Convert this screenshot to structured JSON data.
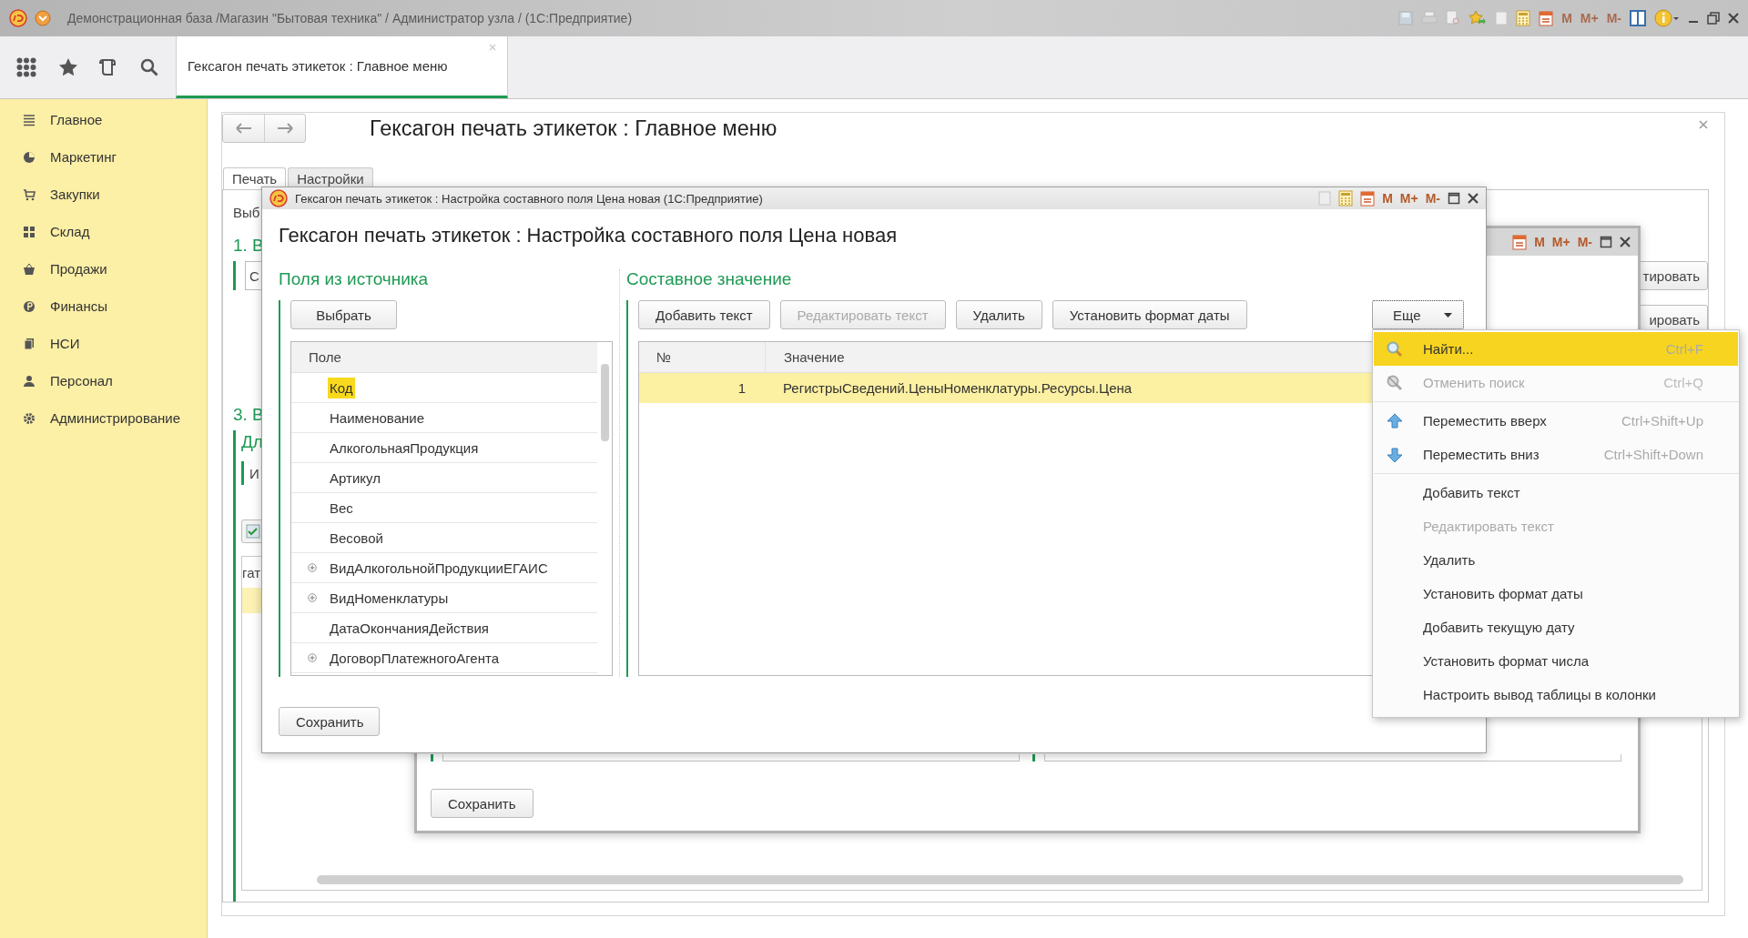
{
  "window": {
    "title": "Демонстрационная база /Магазин \"Бытовая техника\" / Администратор узла /  (1С:Предприятие)",
    "memory_buttons": [
      {
        "label": "M",
        "disabled": true
      },
      {
        "label": "M+",
        "disabled": true
      },
      {
        "label": "M-",
        "disabled": true
      }
    ]
  },
  "open_tabs": [
    {
      "label": "Гексагон печать этикеток : Главное меню",
      "selected": true
    }
  ],
  "sidebar": {
    "items": [
      {
        "label": "Главное"
      },
      {
        "label": "Маркетинг"
      },
      {
        "label": "Закупки"
      },
      {
        "label": "Склад"
      },
      {
        "label": "Продажи"
      },
      {
        "label": "Финансы"
      },
      {
        "label": "НСИ"
      },
      {
        "label": "Персонал"
      },
      {
        "label": "Администрирование"
      }
    ]
  },
  "main_form": {
    "title": "Гексагон печать этикеток : Главное меню",
    "tabs": [
      {
        "label": "Печать",
        "selected": true
      },
      {
        "label": "Настройки",
        "selected": false
      }
    ],
    "hint": "Выб",
    "section_1": {
      "heading": "1. В",
      "field_value": "С"
    },
    "right_buttons": [
      "тировать",
      "ировать"
    ],
    "section_3": {
      "heading": "3. В",
      "group_heading": "Дл",
      "group_label": "И"
    },
    "table": {
      "column": "гат",
      "rows": [
        {
          "selected": true
        }
      ]
    }
  },
  "background_window": {
    "memory_buttons": [
      {
        "label": "M",
        "disabled": false
      },
      {
        "label": "M+",
        "disabled": false
      },
      {
        "label": "M-",
        "disabled": false
      }
    ],
    "save_button": "Сохранить"
  },
  "dialog": {
    "window_title": "Гексагон печать этикеток : Настройка составного поля Цена новая  (1С:Предприятие)",
    "memory_buttons": [
      {
        "label": "M",
        "disabled": false
      },
      {
        "label": "M+",
        "disabled": false
      },
      {
        "label": "M-",
        "disabled": false
      }
    ],
    "title": "Гексагон печать этикеток : Настройка составного поля Цена новая",
    "source_fields": {
      "heading": "Поля из источника",
      "select_button": "Выбрать",
      "column": "Поле",
      "rows": [
        {
          "label": "Код",
          "selected": true,
          "expandable": false
        },
        {
          "label": "Наименование",
          "selected": false,
          "expandable": false
        },
        {
          "label": "АлкогольнаяПродукция",
          "selected": false,
          "expandable": false
        },
        {
          "label": "Артикул",
          "selected": false,
          "expandable": false
        },
        {
          "label": "Вес",
          "selected": false,
          "expandable": false
        },
        {
          "label": "Весовой",
          "selected": false,
          "expandable": false
        },
        {
          "label": "ВидАлкогольнойПродукцииЕГАИС",
          "selected": false,
          "expandable": true
        },
        {
          "label": "ВидНоменклатуры",
          "selected": false,
          "expandable": true
        },
        {
          "label": "ДатаОкончанияДействия",
          "selected": false,
          "expandable": false
        },
        {
          "label": "ДоговорПлатежногоАгента",
          "selected": false,
          "expandable": true
        }
      ]
    },
    "composite": {
      "heading": "Составное значение",
      "buttons": [
        {
          "label": "Добавить текст",
          "disabled": false
        },
        {
          "label": "Редактировать текст",
          "disabled": true
        },
        {
          "label": "Удалить",
          "disabled": false
        },
        {
          "label": "Установить формат даты",
          "disabled": false
        }
      ],
      "more_button": "Еще",
      "columns": [
        "№",
        "Значение"
      ],
      "rows": [
        {
          "number": "1",
          "value": "РегистрыСведений.ЦеныНоменклатуры.Ресурсы.Цена",
          "selected": true
        }
      ]
    },
    "save_button": "Сохранить"
  },
  "menu": {
    "items": [
      {
        "kind": "find",
        "label": "Найти...",
        "shortcut": "Ctrl+F",
        "selected": true,
        "disabled": false
      },
      {
        "kind": "cancel-find",
        "label": "Отменить поиск",
        "shortcut": "Ctrl+Q",
        "selected": false,
        "disabled": true
      },
      {
        "kind": "separator"
      },
      {
        "kind": "move-up",
        "label": "Переместить вверх",
        "shortcut": "Ctrl+Shift+Up",
        "selected": false,
        "disabled": false
      },
      {
        "kind": "move-down",
        "label": "Переместить вниз",
        "shortcut": "Ctrl+Shift+Down",
        "selected": false,
        "disabled": false
      },
      {
        "kind": "separator"
      },
      {
        "kind": "plain",
        "label": "Добавить текст",
        "selected": false,
        "disabled": false
      },
      {
        "kind": "plain",
        "label": "Редактировать текст",
        "selected": false,
        "disabled": true
      },
      {
        "kind": "plain",
        "label": "Удалить",
        "selected": false,
        "disabled": false
      },
      {
        "kind": "plain",
        "label": "Установить формат даты",
        "selected": false,
        "disabled": false
      },
      {
        "kind": "plain",
        "label": "Добавить текущую дату",
        "selected": false,
        "disabled": false
      },
      {
        "kind": "plain",
        "label": "Установить формат числа",
        "selected": false,
        "disabled": false
      },
      {
        "kind": "plain",
        "label": "Настроить вывод таблицы в колонки",
        "selected": false,
        "disabled": false
      }
    ]
  }
}
